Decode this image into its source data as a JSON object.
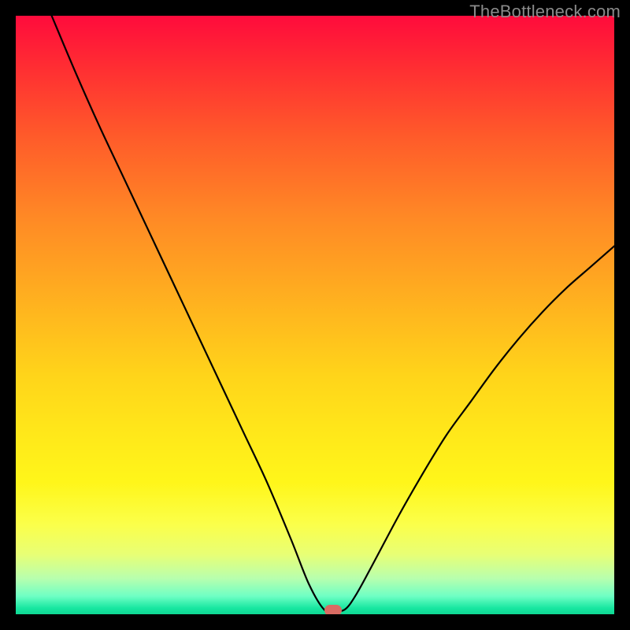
{
  "watermark": "TheBottleneck.com",
  "chart_data": {
    "type": "line",
    "title": "",
    "xlabel": "",
    "ylabel": "",
    "x_range": [
      0,
      100
    ],
    "y_range": [
      0,
      100
    ],
    "grid": false,
    "legend": false,
    "description": "Bottleneck percentage curve over a red-to-green vertical gradient. Curve descends from top-left to a minimum near x≈53 then rises toward the right. A small rounded marker sits at the minimum on the bottom edge.",
    "curve_points": [
      {
        "x": 6.0,
        "y": 100.0
      },
      {
        "x": 10.0,
        "y": 90.5
      },
      {
        "x": 14.0,
        "y": 81.5
      },
      {
        "x": 18.0,
        "y": 73.0
      },
      {
        "x": 22.0,
        "y": 64.5
      },
      {
        "x": 26.0,
        "y": 56.0
      },
      {
        "x": 30.0,
        "y": 47.5
      },
      {
        "x": 34.0,
        "y": 39.0
      },
      {
        "x": 38.0,
        "y": 30.5
      },
      {
        "x": 42.0,
        "y": 22.0
      },
      {
        "x": 46.0,
        "y": 12.5
      },
      {
        "x": 49.0,
        "y": 5.0
      },
      {
        "x": 51.5,
        "y": 0.8
      },
      {
        "x": 53.0,
        "y": 0.6
      },
      {
        "x": 55.0,
        "y": 0.8
      },
      {
        "x": 57.0,
        "y": 3.5
      },
      {
        "x": 60.0,
        "y": 9.0
      },
      {
        "x": 64.0,
        "y": 16.5
      },
      {
        "x": 68.0,
        "y": 23.5
      },
      {
        "x": 72.0,
        "y": 30.0
      },
      {
        "x": 76.0,
        "y": 35.5
      },
      {
        "x": 80.0,
        "y": 41.0
      },
      {
        "x": 84.0,
        "y": 46.0
      },
      {
        "x": 88.0,
        "y": 50.5
      },
      {
        "x": 92.0,
        "y": 54.5
      },
      {
        "x": 96.0,
        "y": 58.0
      },
      {
        "x": 100.0,
        "y": 61.5
      }
    ],
    "marker": {
      "x": 53.0,
      "y": 0.6,
      "color": "#d96b63"
    },
    "gradient_stops": [
      {
        "pos": 0,
        "color": "#ff0b3c"
      },
      {
        "pos": 50,
        "color": "#ffd41a"
      },
      {
        "pos": 100,
        "color": "#0fd893"
      }
    ]
  }
}
